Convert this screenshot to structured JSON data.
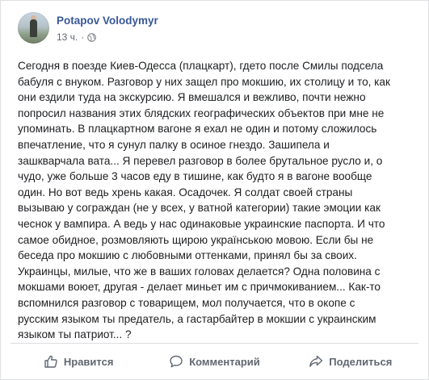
{
  "post": {
    "author": "Potapov Volodymyr",
    "time": "13 ч.",
    "separator": "·",
    "privacy_icon": "globe-icon",
    "lines": [
      "Сегодня в поезде Киев-Одесса (плацкарт), гдето после Смилы подсела",
      "бабуля с внуком. Разговор у них защел про мокшию, их столицу и то, как",
      "они ездили туда на экскурсию. Я вмешался и вежливо, почти нежно",
      "попросил названия этих блядских географических объектов при мне не",
      "упоминать. В плацкартном вагоне я ехал не один и потому сложилось",
      "впечатление, что я сунул палку в осиное гнездо. Зашипела и",
      "зашкварчала вата... Я перевел разговор в более брутальное русло и, о",
      "чудо, уже больше 3 часов еду в тишине, как будто я в вагоне вообще",
      "один. Но вот ведь хрень какая. Осадочек. Я солдат своей страны",
      "вызываю у сограждан (не у всех, у ватной категории) такие эмоции как",
      "чеснок у вампира. А ведь у нас одинаковые украинские паспорта. И что",
      "самое обидное, розмовляють щирою українською мовою. Если бы не",
      "беседа про мокшию с любовными оттенками, принял бы за своих.",
      "Украинцы, милые, что же в ваших головах делается? Одна половина с",
      "мокшами воюет, другая - делает миньет им с причмокиванием... Как-то",
      "вспомнился разговор с товарищем, мол получается, что в окопе с",
      "русским языком ты предатель, а гастарбайтер в мокшии с украинским",
      "языком ты патриот... ?"
    ]
  },
  "actions": {
    "like_label": "Нравится",
    "like_icon": "thumbs-up-icon",
    "comment_label": "Комментарий",
    "comment_icon": "comment-icon",
    "share_label": "Поделиться",
    "share_icon": "share-icon"
  },
  "colors": {
    "author": "#385898",
    "text": "#1c1e21",
    "muted": "#606770"
  }
}
